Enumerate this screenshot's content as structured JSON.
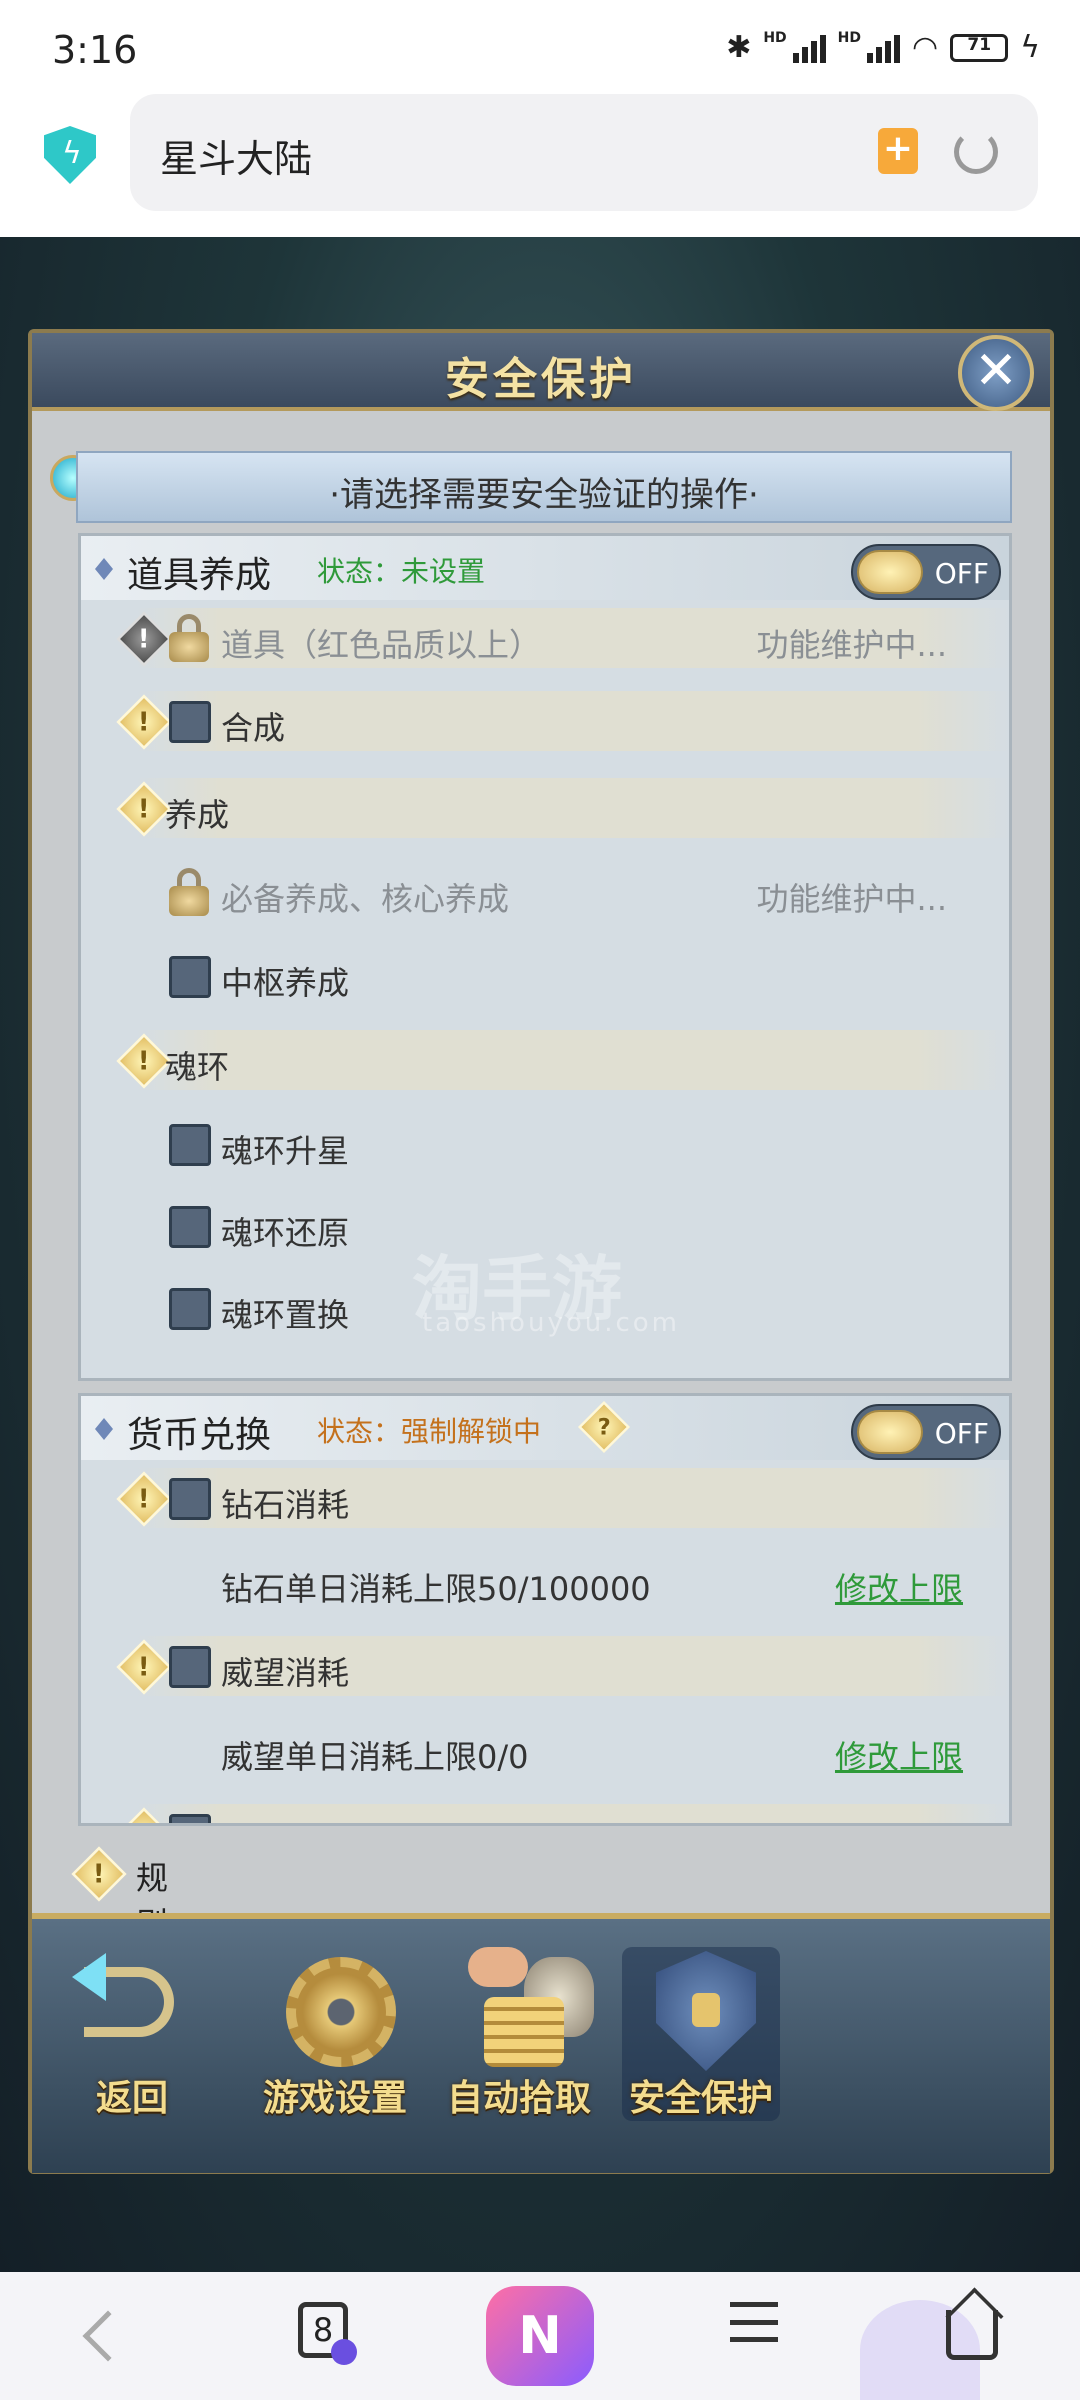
{
  "status_bar": {
    "time": "3:16",
    "hd1": "HD",
    "hd2": "HD",
    "battery": "71"
  },
  "browser": {
    "url_text": "星斗大陆"
  },
  "dialog": {
    "title": "安全保护",
    "banner": "·请选择需要安全验证的操作·",
    "section1": {
      "title": "道具养成",
      "status": "状态：未设置",
      "status_color": "#2f9a3a",
      "toggle": "OFF",
      "rows": [
        {
          "label": "道具（红色品质以上）",
          "right": "功能维护中..."
        },
        {
          "label": "合成"
        },
        {
          "label": "养成"
        },
        {
          "label": "必备养成、核心养成",
          "right": "功能维护中..."
        },
        {
          "label": "中枢养成"
        },
        {
          "label": "魂环"
        },
        {
          "label": "魂环升星"
        },
        {
          "label": "魂环还原"
        },
        {
          "label": "魂环置换"
        }
      ]
    },
    "section2": {
      "title": "货币兑换",
      "status": "状态：强制解锁中",
      "status_color": "#c4711c",
      "toggle": "OFF",
      "help_icon": "?",
      "rows": [
        {
          "label": "钻石消耗"
        },
        {
          "label": "钻石单日消耗上限50/100000",
          "link": "修改上限"
        },
        {
          "label": "威望消耗"
        },
        {
          "label": "威望单日消耗上限0/0",
          "link": "修改上限"
        }
      ]
    },
    "rules_label": "规则说明",
    "watermark": "淘手游",
    "watermark_sub": "taoshouyou.com"
  },
  "bottom_nav": {
    "back": "返回",
    "settings": "游戏设置",
    "auto_pick": "自动拾取",
    "security": "安全保护"
  },
  "system_nav": {
    "tab_count": "8",
    "ai_label": "N"
  }
}
